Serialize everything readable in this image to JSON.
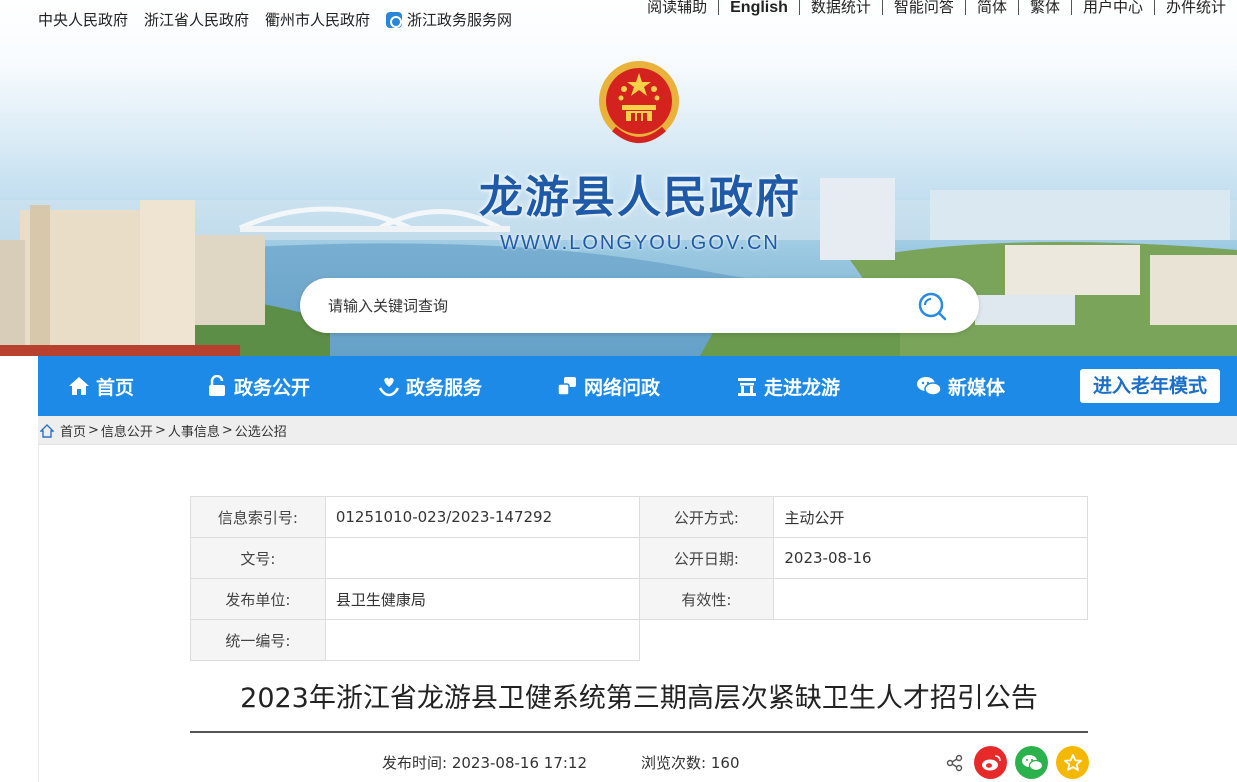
{
  "topbar": {
    "left_links": [
      "中央人民政府",
      "浙江省人民政府",
      "衢州市人民政府"
    ],
    "zwfw_label": "浙江政务服务网",
    "right_links": [
      "阅读辅助",
      "English",
      "数据统计",
      "智能问答",
      "简体",
      "繁体",
      "用户中心",
      "办件统计"
    ]
  },
  "header": {
    "site_title": "龙游县人民政府",
    "site_url": "WWW.LONGYOU.GOV.CN"
  },
  "search": {
    "placeholder": "请输入关键词查询"
  },
  "nav": {
    "items": [
      "首页",
      "政务公开",
      "政务服务",
      "网络问政",
      "走进龙游",
      "新媒体"
    ],
    "elder_mode": "进入老年模式"
  },
  "breadcrumb": {
    "items": [
      "首页",
      "信息公开",
      "人事信息",
      "公选公招"
    ],
    "separator": ">"
  },
  "info": {
    "index_label": "信息索引号:",
    "index_value": "01251010-023/2023-147292",
    "method_label": "公开方式:",
    "method_value": "主动公开",
    "docno_label": "文号:",
    "docno_value": "",
    "date_label": "公开日期:",
    "date_value": "2023-08-16",
    "publisher_label": "发布单位:",
    "publisher_value": "县卫生健康局",
    "validity_label": "有效性:",
    "validity_value": "",
    "serial_label": "统一编号:",
    "serial_value": ""
  },
  "article": {
    "title": "2023年浙江省龙游县卫健系统第三期高层次紧缺卫生人才招引公告",
    "publish_time_label": "发布时间:",
    "publish_time": "2023-08-16 17:12",
    "views_label": "浏览次数:",
    "views": "160"
  },
  "colors": {
    "nav_bg": "#1c8ae6",
    "title_blue": "#1f5aa8",
    "weibo_red": "#e8292a",
    "wechat_green": "#2bb24c",
    "star_yellow": "#f5b800"
  },
  "icons": [
    "home-icon",
    "unlock-icon",
    "heart-hand-icon",
    "chat-window-icon",
    "landmark-icon",
    "wechat-icon",
    "search-icon",
    "share-icon",
    "weibo-icon",
    "star-icon"
  ]
}
